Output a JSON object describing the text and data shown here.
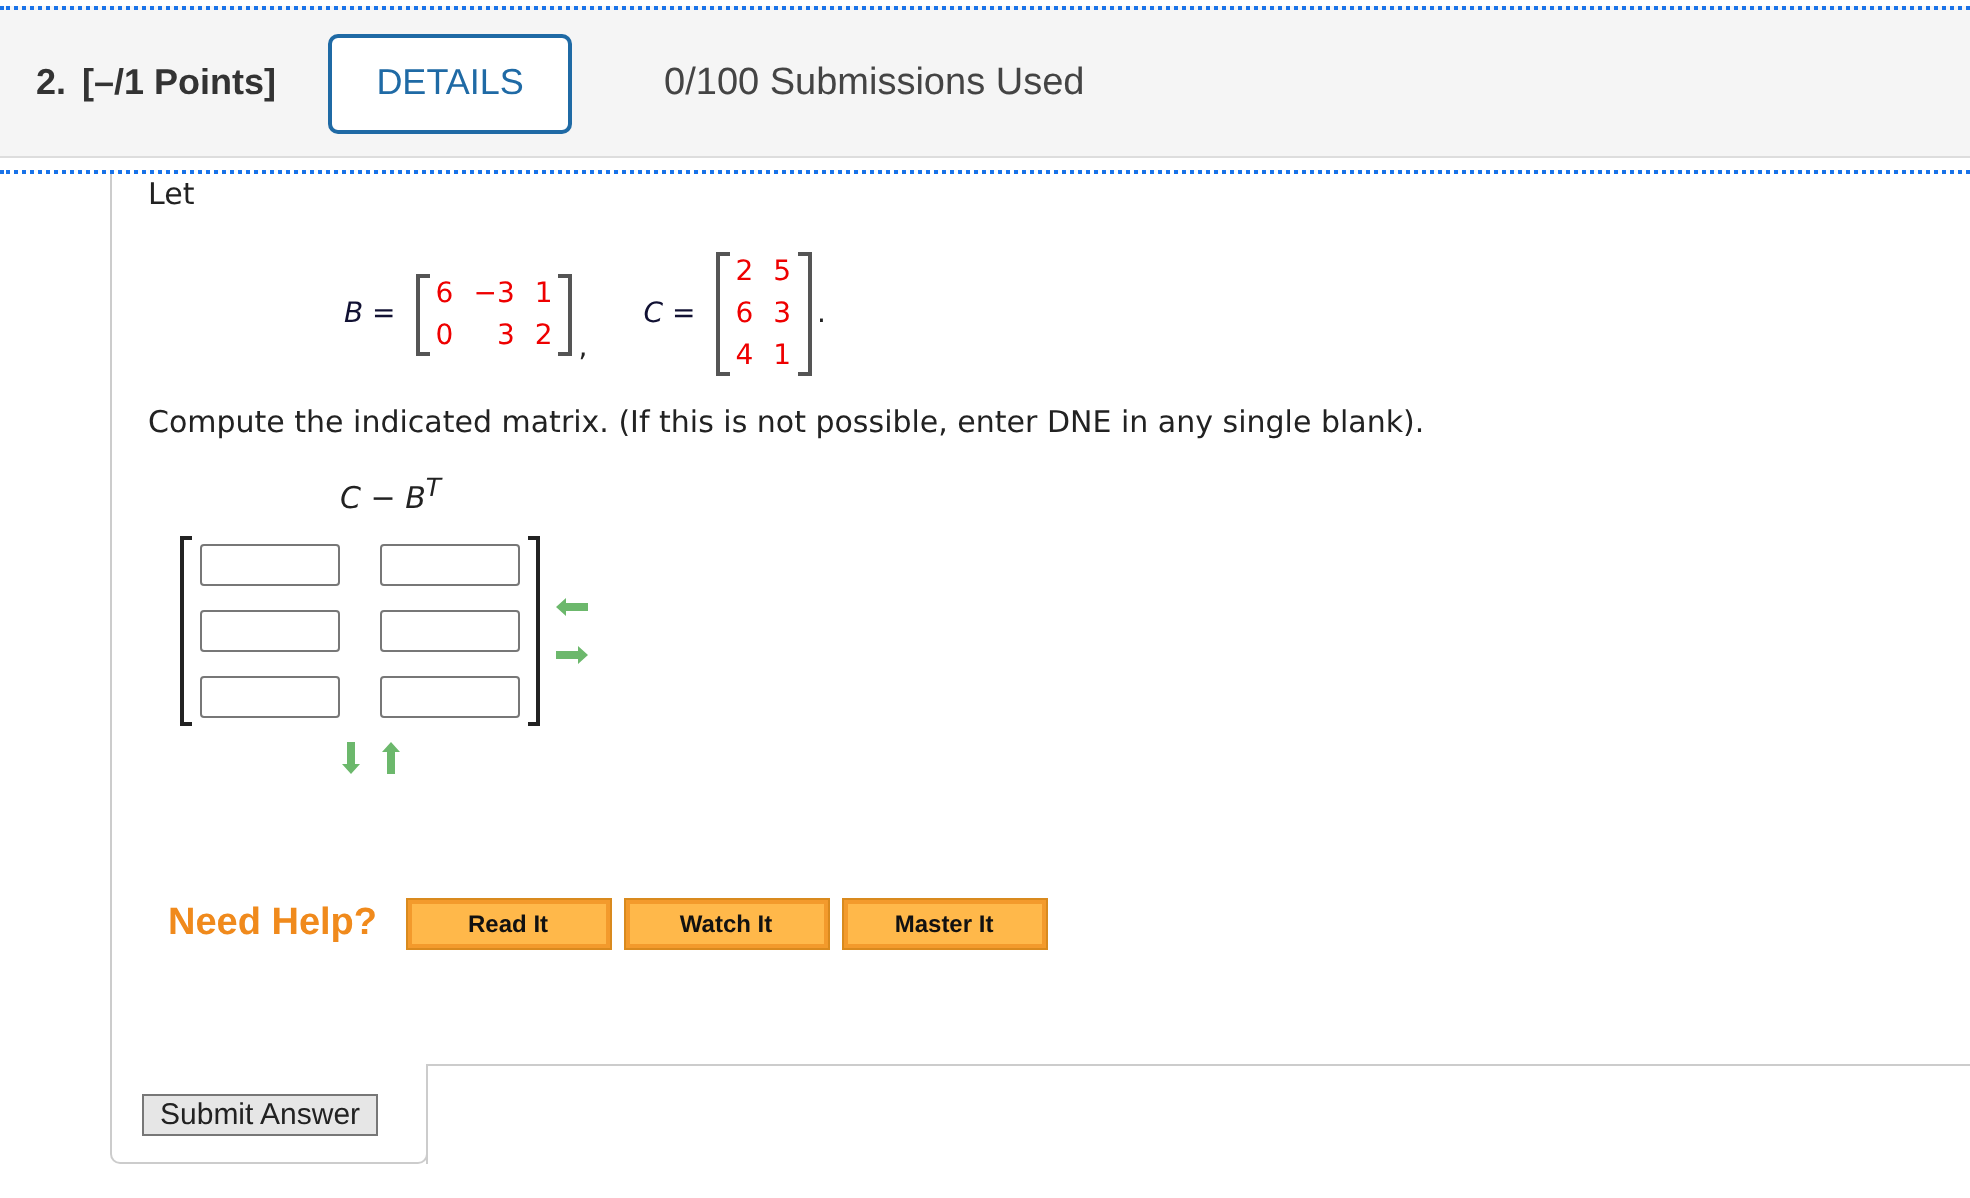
{
  "question": {
    "number": "2.",
    "points": "[–/1 Points]",
    "details_button": "DETAILS",
    "submissions": "0/100 Submissions Used"
  },
  "intro": "Let",
  "matrices": [
    {
      "name": "B =",
      "rows": [
        [
          "6",
          "−3",
          "1"
        ],
        [
          "0",
          "3",
          "2"
        ]
      ],
      "trail": ","
    },
    {
      "name": "C =",
      "rows": [
        [
          "2",
          "5"
        ],
        [
          "6",
          "3"
        ],
        [
          "4",
          "1"
        ]
      ],
      "trail": "."
    }
  ],
  "instruction": "Compute the indicated matrix. (If this is not possible, enter DNE in any single blank).",
  "expression": "C − B$^{T}$",
  "answer_rows": [
    [
      {
        "kind": "blank"
      },
      {
        "kind": "blank"
      }
    ],
    [
      {
        "kind": "blank"
      },
      {
        "kind": "blank"
      }
    ],
    [
      {
        "kind": "blank"
      },
      {
        "kind": "blank"
      }
    ]
  ],
  "help": {
    "label": "Need Help?",
    "buttons": [
      "Read It",
      "Watch It",
      "Master It"
    ]
  },
  "submit_button": "Submit Answer"
}
